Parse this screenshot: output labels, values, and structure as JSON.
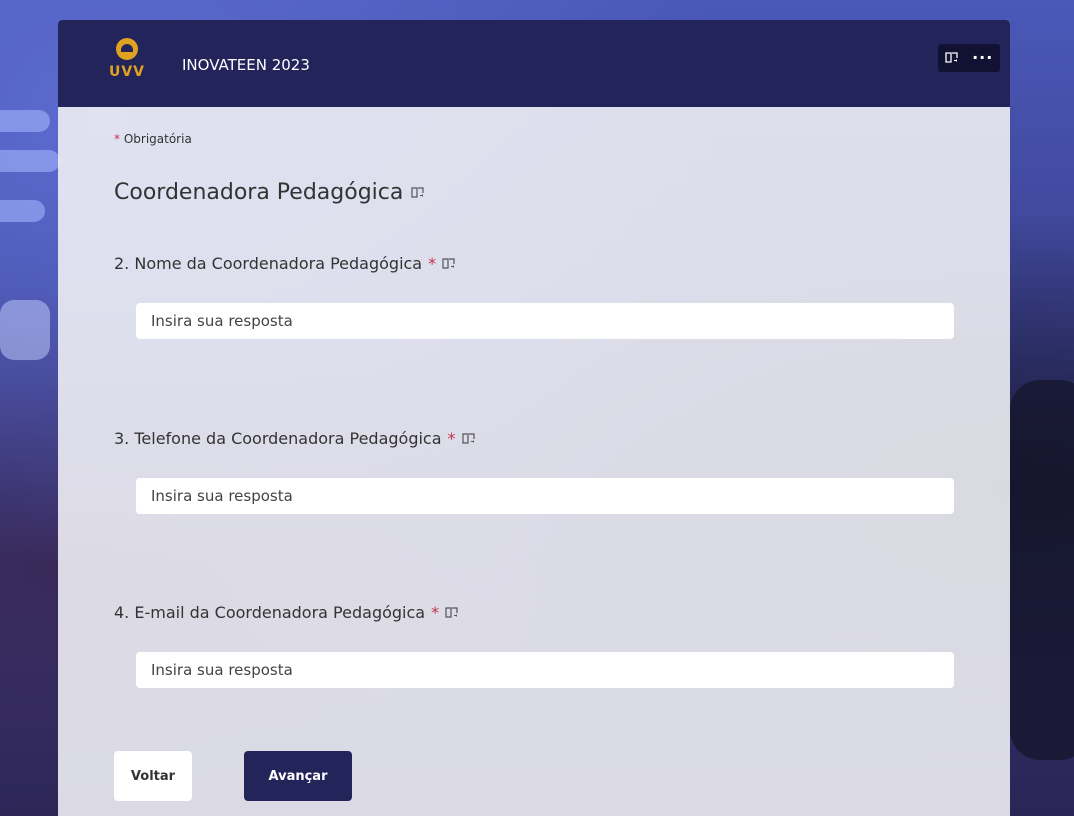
{
  "header": {
    "logo_text": "UVV",
    "title": "INOVATEEN 2023",
    "reader_icon": "immersive-reader-icon",
    "more_icon": "more-options-icon",
    "more_glyph": "···"
  },
  "form": {
    "required_star": "*",
    "required_label": "Obrigatória",
    "section_title": "Coordenadora Pedagógica",
    "questions": [
      {
        "label": "2. Nome da Coordenadora Pedagógica",
        "required": "*",
        "placeholder": "Insira sua resposta",
        "value": ""
      },
      {
        "label": "3. Telefone da Coordenadora Pedagógica",
        "required": "*",
        "placeholder": "Insira sua resposta",
        "value": ""
      },
      {
        "label": "4. E-mail da Coordenadora Pedagógica",
        "required": "*",
        "placeholder": "Insira sua resposta",
        "value": ""
      }
    ]
  },
  "buttons": {
    "back": "Voltar",
    "next": "Avançar"
  },
  "colors": {
    "header_bg": "#23245a",
    "required": "#c4314b",
    "logo_gold": "#e0a321"
  }
}
